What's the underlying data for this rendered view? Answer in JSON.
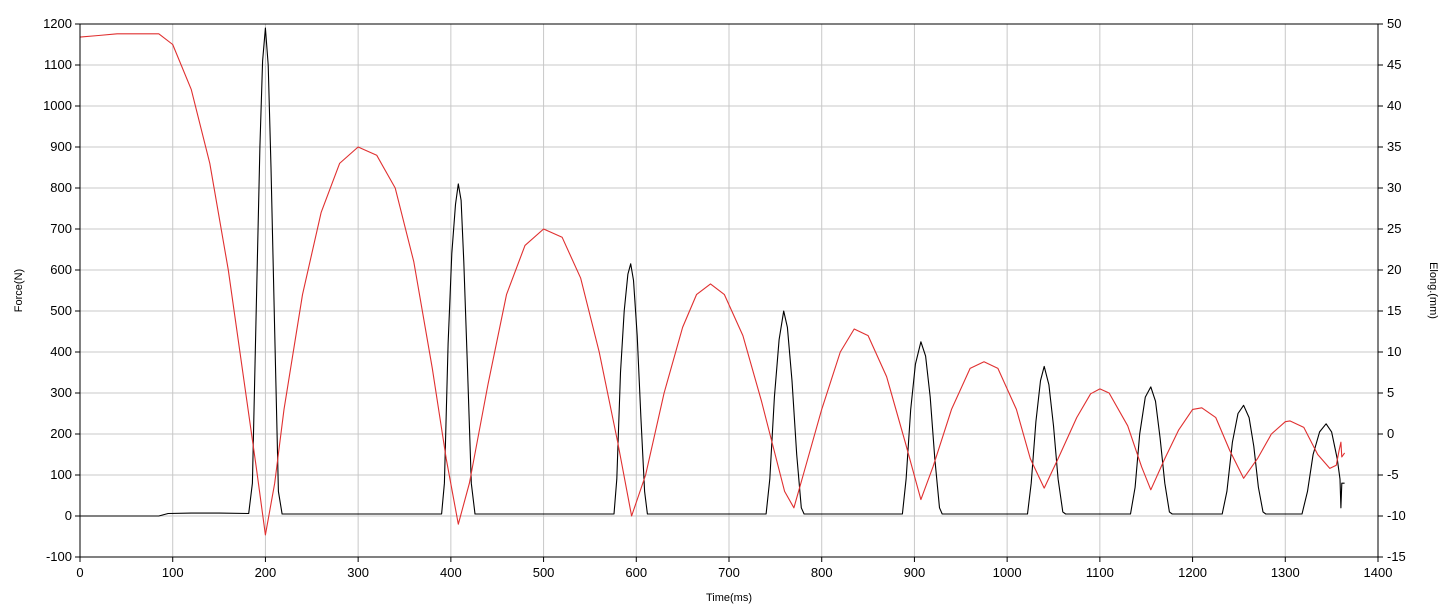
{
  "chart_data": {
    "type": "line",
    "title": "",
    "xlabel": "Time(ms)",
    "ylabel": "Force(N)",
    "y2label": "Elong.(mm)",
    "xlim": [
      0,
      1400
    ],
    "ylim": [
      -100,
      1200
    ],
    "y2lim": [
      -15,
      50
    ],
    "x_ticks": [
      0,
      100,
      200,
      300,
      400,
      500,
      600,
      700,
      800,
      900,
      1000,
      1100,
      1200,
      1300,
      1400
    ],
    "y_ticks": [
      -100,
      0,
      100,
      200,
      300,
      400,
      500,
      600,
      700,
      800,
      900,
      1000,
      1100,
      1200
    ],
    "y2_ticks": [
      -15,
      -10,
      -5,
      0,
      5,
      10,
      15,
      20,
      25,
      30,
      35,
      40,
      45,
      50
    ],
    "grid": true,
    "legend": "none",
    "colors": {
      "force": "#000000",
      "elongation": "#e03030",
      "grid": "#c8c8c8"
    },
    "series": [
      {
        "axis": "left",
        "color": "#000000",
        "points": [
          [
            0,
            0
          ],
          [
            85,
            0
          ],
          [
            95,
            6
          ],
          [
            120,
            7
          ],
          [
            150,
            7
          ],
          [
            182,
            6
          ],
          [
            186,
            80
          ],
          [
            190,
            500
          ],
          [
            194,
            900
          ],
          [
            197,
            1110
          ],
          [
            200,
            1190
          ],
          [
            203,
            1100
          ],
          [
            206,
            850
          ],
          [
            210,
            450
          ],
          [
            214,
            60
          ],
          [
            218,
            5
          ],
          [
            300,
            5
          ],
          [
            390,
            5
          ],
          [
            393,
            80
          ],
          [
            397,
            420
          ],
          [
            401,
            640
          ],
          [
            405,
            760
          ],
          [
            408,
            810
          ],
          [
            411,
            770
          ],
          [
            414,
            620
          ],
          [
            418,
            360
          ],
          [
            422,
            80
          ],
          [
            426,
            5
          ],
          [
            500,
            5
          ],
          [
            576,
            5
          ],
          [
            579,
            90
          ],
          [
            583,
            350
          ],
          [
            587,
            500
          ],
          [
            591,
            590
          ],
          [
            594,
            615
          ],
          [
            597,
            575
          ],
          [
            601,
            440
          ],
          [
            605,
            240
          ],
          [
            609,
            60
          ],
          [
            612,
            5
          ],
          [
            700,
            5
          ],
          [
            740,
            5
          ],
          [
            744,
            90
          ],
          [
            749,
            290
          ],
          [
            754,
            430
          ],
          [
            759,
            500
          ],
          [
            763,
            460
          ],
          [
            768,
            330
          ],
          [
            773,
            150
          ],
          [
            778,
            20
          ],
          [
            781,
            5
          ],
          [
            850,
            5
          ],
          [
            887,
            5
          ],
          [
            891,
            90
          ],
          [
            896,
            260
          ],
          [
            901,
            370
          ],
          [
            907,
            425
          ],
          [
            912,
            390
          ],
          [
            917,
            290
          ],
          [
            922,
            140
          ],
          [
            927,
            20
          ],
          [
            930,
            5
          ],
          [
            1000,
            5
          ],
          [
            1022,
            5
          ],
          [
            1026,
            80
          ],
          [
            1031,
            230
          ],
          [
            1036,
            330
          ],
          [
            1040,
            365
          ],
          [
            1045,
            320
          ],
          [
            1050,
            220
          ],
          [
            1055,
            90
          ],
          [
            1060,
            10
          ],
          [
            1063,
            5
          ],
          [
            1100,
            5
          ],
          [
            1133,
            5
          ],
          [
            1138,
            70
          ],
          [
            1143,
            200
          ],
          [
            1149,
            290
          ],
          [
            1155,
            315
          ],
          [
            1160,
            280
          ],
          [
            1165,
            190
          ],
          [
            1170,
            80
          ],
          [
            1175,
            10
          ],
          [
            1178,
            5
          ],
          [
            1200,
            5
          ],
          [
            1232,
            5
          ],
          [
            1237,
            60
          ],
          [
            1243,
            180
          ],
          [
            1249,
            250
          ],
          [
            1255,
            270
          ],
          [
            1261,
            240
          ],
          [
            1266,
            170
          ],
          [
            1271,
            70
          ],
          [
            1276,
            10
          ],
          [
            1279,
            5
          ],
          [
            1300,
            5
          ],
          [
            1318,
            5
          ],
          [
            1324,
            60
          ],
          [
            1330,
            150
          ],
          [
            1337,
            205
          ],
          [
            1344,
            225
          ],
          [
            1350,
            205
          ],
          [
            1356,
            140
          ],
          [
            1359,
            90
          ],
          [
            1360,
            20
          ],
          [
            1361,
            80
          ],
          [
            1364,
            80
          ]
        ]
      },
      {
        "axis": "right",
        "color": "#e03030",
        "points": [
          [
            0,
            48.4
          ],
          [
            20,
            48.6
          ],
          [
            40,
            48.8
          ],
          [
            85,
            48.8
          ],
          [
            100,
            47.5
          ],
          [
            120,
            42
          ],
          [
            140,
            33
          ],
          [
            160,
            20
          ],
          [
            180,
            4
          ],
          [
            190,
            -4
          ],
          [
            200,
            -12.3
          ],
          [
            210,
            -6
          ],
          [
            220,
            3
          ],
          [
            240,
            17
          ],
          [
            260,
            27
          ],
          [
            280,
            33
          ],
          [
            300,
            35.0
          ],
          [
            320,
            34
          ],
          [
            340,
            30
          ],
          [
            360,
            21
          ],
          [
            380,
            8
          ],
          [
            395,
            -3
          ],
          [
            408,
            -11.0
          ],
          [
            420,
            -6
          ],
          [
            440,
            6
          ],
          [
            460,
            17
          ],
          [
            480,
            23
          ],
          [
            500,
            25.0
          ],
          [
            520,
            24
          ],
          [
            540,
            19
          ],
          [
            560,
            10
          ],
          [
            580,
            -1
          ],
          [
            595,
            -10.0
          ],
          [
            610,
            -5
          ],
          [
            630,
            5
          ],
          [
            650,
            13
          ],
          [
            665,
            17
          ],
          [
            680,
            18.3
          ],
          [
            695,
            17
          ],
          [
            715,
            12
          ],
          [
            735,
            4
          ],
          [
            760,
            -7
          ],
          [
            770,
            -9.0
          ],
          [
            780,
            -5
          ],
          [
            800,
            3
          ],
          [
            820,
            10
          ],
          [
            835,
            12.8
          ],
          [
            850,
            12
          ],
          [
            870,
            7
          ],
          [
            890,
            -1
          ],
          [
            907,
            -8.0
          ],
          [
            920,
            -4
          ],
          [
            940,
            3
          ],
          [
            960,
            8
          ],
          [
            975,
            8.8
          ],
          [
            990,
            8
          ],
          [
            1010,
            3
          ],
          [
            1025,
            -3
          ],
          [
            1040,
            -6.6
          ],
          [
            1055,
            -3
          ],
          [
            1075,
            2
          ],
          [
            1090,
            4.9
          ],
          [
            1100,
            5.5
          ],
          [
            1110,
            5
          ],
          [
            1130,
            1
          ],
          [
            1145,
            -4
          ],
          [
            1155,
            -6.8
          ],
          [
            1170,
            -3
          ],
          [
            1185,
            0.5
          ],
          [
            1200,
            3
          ],
          [
            1210,
            3.2
          ],
          [
            1225,
            2
          ],
          [
            1240,
            -2
          ],
          [
            1255,
            -5.4
          ],
          [
            1270,
            -3
          ],
          [
            1285,
            0
          ],
          [
            1300,
            1.5
          ],
          [
            1305,
            1.6
          ],
          [
            1320,
            0.8
          ],
          [
            1335,
            -2.5
          ],
          [
            1348,
            -4.2
          ],
          [
            1355,
            -3.8
          ],
          [
            1358,
            -2
          ],
          [
            1360,
            -1
          ],
          [
            1361,
            -2.8
          ],
          [
            1364,
            -2.3
          ]
        ]
      }
    ]
  }
}
